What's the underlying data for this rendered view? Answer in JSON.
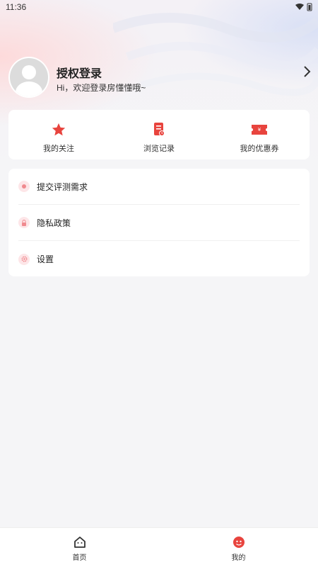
{
  "status_bar": {
    "time": "11:36"
  },
  "profile": {
    "title": "授权登录",
    "subtitle": "Hi，欢迎登录房懂懂哦~"
  },
  "quick_actions": [
    {
      "label": "我的关注",
      "icon": "star-icon",
      "color": "#e8443e"
    },
    {
      "label": "浏览记录",
      "icon": "history-icon",
      "color": "#e8443e"
    },
    {
      "label": "我的优惠券",
      "icon": "coupon-icon",
      "color": "#e8443e"
    }
  ],
  "menu": [
    {
      "label": "提交评测需求",
      "icon": "submit-icon"
    },
    {
      "label": "隐私政策",
      "icon": "lock-icon"
    },
    {
      "label": "设置",
      "icon": "gear-icon"
    }
  ],
  "tabbar": [
    {
      "label": "首页",
      "icon": "home-icon"
    },
    {
      "label": "我的",
      "icon": "profile-icon"
    }
  ],
  "accent_color": "#e8443e"
}
